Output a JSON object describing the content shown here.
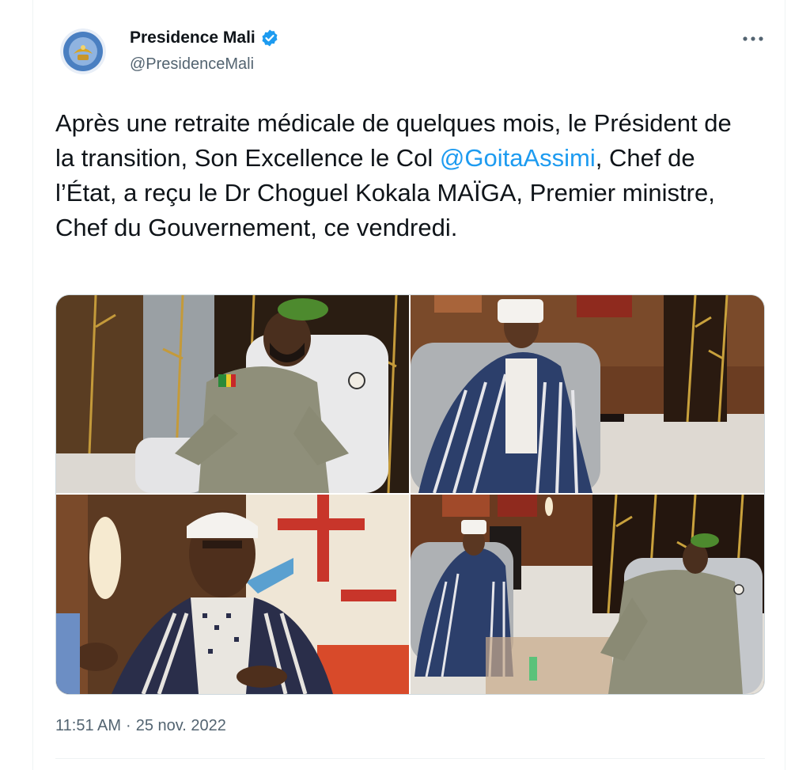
{
  "author": {
    "display_name": "Presidence Mali",
    "handle": "@PresidenceMali",
    "verified": true,
    "avatar_icon": "presidency-seal-icon",
    "accent_color": "#1d9bf0"
  },
  "tweet": {
    "text_before_mention": "Après une retraite médicale de quelques mois, le Président de la transition, Son Excellence le Col ",
    "mention": "@GoitaAssimi",
    "text_after_mention": ", Chef de l’État, a reçu le Dr Choguel Kokala MAÏGA, Premier ministre, Chef du Gouvernement, ce vendredi."
  },
  "media": {
    "photos": [
      {
        "alt": "photo-1"
      },
      {
        "alt": "photo-2"
      },
      {
        "alt": "photo-3"
      },
      {
        "alt": "photo-4"
      }
    ]
  },
  "meta": {
    "time": "11:51 AM",
    "separator": "·",
    "date": "25 nov. 2022"
  },
  "icons": {
    "more": "more-options-icon",
    "verified": "verified-badge-icon"
  }
}
